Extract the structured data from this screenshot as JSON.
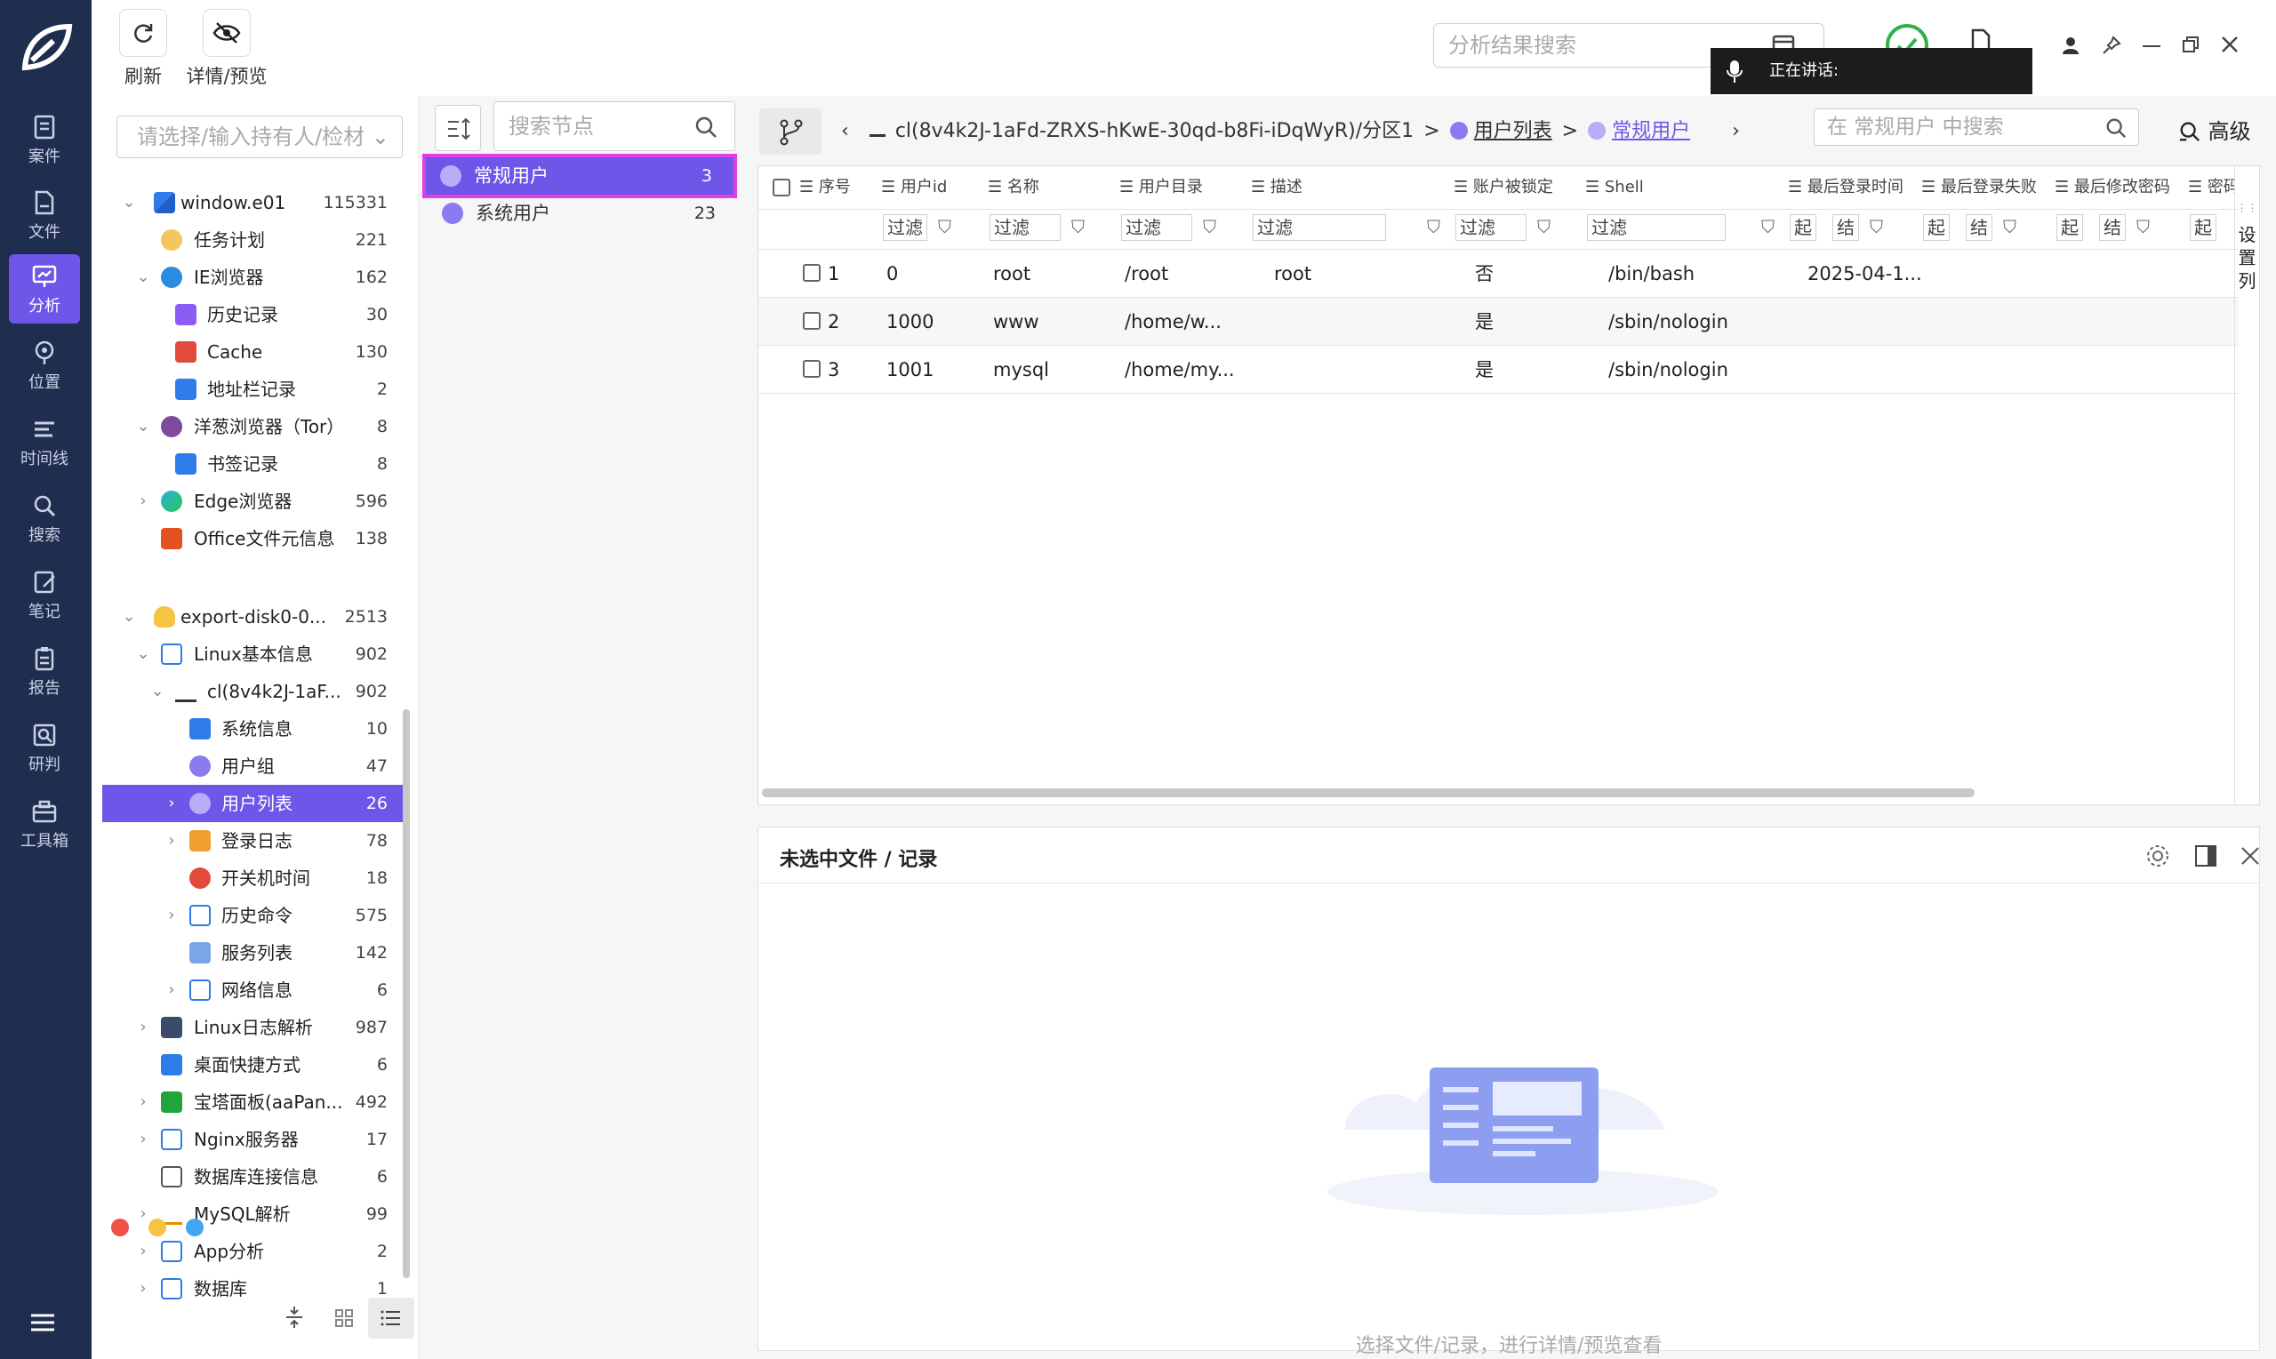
{
  "toolbar": {
    "refresh_label": "刷新",
    "preview_label": "详情/预览"
  },
  "analysis_search": {
    "placeholder": "分析结果搜索"
  },
  "speaking_indicator": "正在讲话:",
  "nav": [
    {
      "label": "案件",
      "icon": "case-icon"
    },
    {
      "label": "文件",
      "icon": "file-icon"
    },
    {
      "label": "分析",
      "icon": "analysis-icon",
      "active": true
    },
    {
      "label": "位置",
      "icon": "location-icon"
    },
    {
      "label": "时间线",
      "icon": "timeline-icon"
    },
    {
      "label": "搜索",
      "icon": "search-icon"
    },
    {
      "label": "笔记",
      "icon": "notes-icon"
    },
    {
      "label": "报告",
      "icon": "report-icon"
    },
    {
      "label": "研判",
      "icon": "judge-icon"
    },
    {
      "label": "工具箱",
      "icon": "toolbox-icon"
    }
  ],
  "holder_select": {
    "placeholder": "请选择/输入持有人/检材"
  },
  "tree": [
    {
      "label": "window.e01",
      "count": "115331"
    },
    {
      "label": "任务计划",
      "count": "221"
    },
    {
      "label": "IE浏览器",
      "count": "162"
    },
    {
      "label": "历史记录",
      "count": "30"
    },
    {
      "label": "Cache",
      "count": "130"
    },
    {
      "label": "地址栏记录",
      "count": "2"
    },
    {
      "label": "洋葱浏览器（Tor）",
      "count": "8"
    },
    {
      "label": "书签记录",
      "count": "8"
    },
    {
      "label": "Edge浏览器",
      "count": "596"
    },
    {
      "label": "Office文件元信息",
      "count": "138"
    },
    {
      "label": "export-disk0-0...",
      "count": "2513"
    },
    {
      "label": "Linux基本信息",
      "count": "902"
    },
    {
      "label": "cl(8v4k2J-1aF...",
      "count": "902"
    },
    {
      "label": "系统信息",
      "count": "10"
    },
    {
      "label": "用户组",
      "count": "47"
    },
    {
      "label": "用户列表",
      "count": "26"
    },
    {
      "label": "登录日志",
      "count": "78"
    },
    {
      "label": "开关机时间",
      "count": "18"
    },
    {
      "label": "历史命令",
      "count": "575"
    },
    {
      "label": "服务列表",
      "count": "142"
    },
    {
      "label": "网络信息",
      "count": "6"
    },
    {
      "label": "Linux日志解析",
      "count": "987"
    },
    {
      "label": "桌面快捷方式",
      "count": "6"
    },
    {
      "label": "宝塔面板(aaPan...",
      "count": "492"
    },
    {
      "label": "Nginx服务器",
      "count": "17"
    },
    {
      "label": "数据库连接信息",
      "count": "6"
    },
    {
      "label": "MySQL解析",
      "count": "99"
    },
    {
      "label": "App分析",
      "count": "2"
    },
    {
      "label": "数据库",
      "count": "1"
    }
  ],
  "node_search": {
    "placeholder": "搜索节点"
  },
  "nodes": [
    {
      "label": "常规用户",
      "count": "3"
    },
    {
      "label": "系统用户",
      "count": "23"
    }
  ],
  "breadcrumb": {
    "path": "cl(8v4k2J-1aFd-ZRXS-hKwE-30qd-b8Fi-iDqWyR)/分区1",
    "sep": ">",
    "list": "用户列表",
    "current": "常规用户"
  },
  "table_search": {
    "placeholder": "在 常规用户 中搜索"
  },
  "advanced_label": "高级",
  "columns": [
    "序号",
    "用户id",
    "名称",
    "用户目录",
    "描述",
    "账户被锁定",
    "Shell",
    "最后登录时间",
    "最后登录失败",
    "最后修改密码",
    "密码"
  ],
  "filter": {
    "text": "过滤",
    "start": "起",
    "end": "结"
  },
  "rows": [
    {
      "idx": "1",
      "uid": "0",
      "name": "root",
      "home": "/root",
      "desc": "root",
      "locked": "否",
      "shell": "/bin/bash",
      "last_login": "2025-04-1..."
    },
    {
      "idx": "2",
      "uid": "1000",
      "name": "www",
      "home": "/home/w...",
      "desc": "",
      "locked": "是",
      "shell": "/sbin/nologin",
      "last_login": ""
    },
    {
      "idx": "3",
      "uid": "1001",
      "name": "mysql",
      "home": "/home/my...",
      "desc": "",
      "locked": "是",
      "shell": "/sbin/nologin",
      "last_login": ""
    }
  ],
  "settings_column_label": "设置列",
  "detail": {
    "title": "未选中文件 / 记录",
    "empty_text": "选择文件/记录，进行详情/预览查看"
  },
  "colors": {
    "accent": "#6f55e8",
    "rail": "#1f2d4e",
    "highlight_border": "#e23de2"
  }
}
